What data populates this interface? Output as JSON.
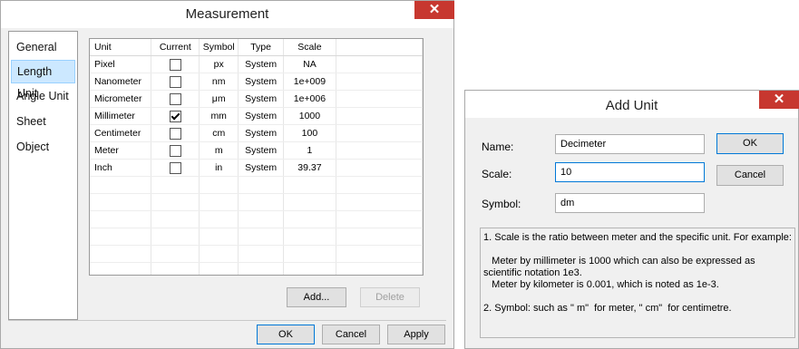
{
  "measurement": {
    "title": "Measurement",
    "close_glyph": "✕",
    "nav": [
      "General",
      "Length Unit",
      "Angle Unit",
      "Sheet",
      "Object"
    ],
    "selected_nav": "Length Unit",
    "table": {
      "headers": [
        "Unit",
        "Current",
        "Symbol",
        "Type",
        "Scale"
      ],
      "rows": [
        {
          "unit": "Pixel",
          "current": false,
          "symbol": "px",
          "type": "System",
          "scale": "NA"
        },
        {
          "unit": "Nanometer",
          "current": false,
          "symbol": "nm",
          "type": "System",
          "scale": "1e+009"
        },
        {
          "unit": "Micrometer",
          "current": false,
          "symbol": "μm",
          "type": "System",
          "scale": "1e+006"
        },
        {
          "unit": "Millimeter",
          "current": true,
          "symbol": "mm",
          "type": "System",
          "scale": "1000"
        },
        {
          "unit": "Centimeter",
          "current": false,
          "symbol": "cm",
          "type": "System",
          "scale": "100"
        },
        {
          "unit": "Meter",
          "current": false,
          "symbol": "m",
          "type": "System",
          "scale": "1"
        },
        {
          "unit": "Inch",
          "current": false,
          "symbol": "in",
          "type": "System",
          "scale": "39.37"
        }
      ]
    },
    "add_label": "Add...",
    "delete_label": "Delete",
    "ok_label": "OK",
    "cancel_label": "Cancel",
    "apply_label": "Apply"
  },
  "add_unit": {
    "title": "Add Unit",
    "close_glyph": "✕",
    "name_label": "Name:",
    "name_value": "Decimeter",
    "scale_label": "Scale:",
    "scale_value": "10",
    "symbol_label": "Symbol:",
    "symbol_value": "dm",
    "ok_label": "OK",
    "cancel_label": "Cancel",
    "note": [
      "1. Scale is the ratio between meter and the specific unit. For example:",
      "",
      "   Meter by millimeter is 1000 which can also be expressed as scientific notation 1e3.",
      "   Meter by kilometer is 0.001, which is noted as 1e-3.",
      "",
      "2. Symbol: such as \" m\"  for meter, \" cm\"  for centimetre."
    ]
  }
}
